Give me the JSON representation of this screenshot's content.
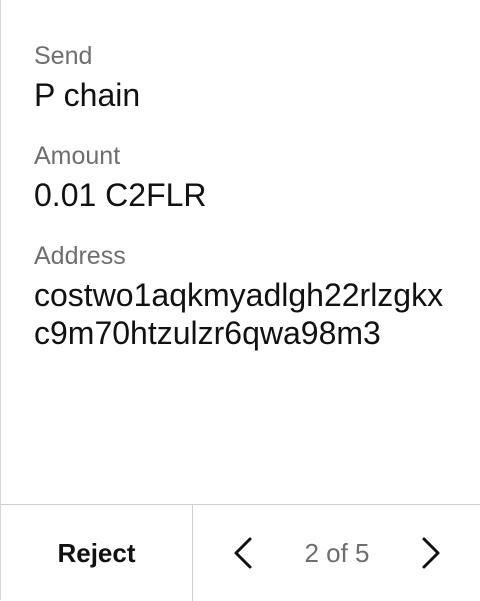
{
  "fields": [
    {
      "label": "Send",
      "value": "P chain"
    },
    {
      "label": "Amount",
      "value": "0.01 C2FLR"
    },
    {
      "label": "Address",
      "value": "costwo1aqkmyadlgh22rlzgkxc9m70htzulzr6qwa98m3"
    }
  ],
  "footer": {
    "reject_label": "Reject",
    "page_indicator": "2 of 5",
    "prev_icon": "chevron-left-icon",
    "next_icon": "chevron-right-icon"
  },
  "colors": {
    "label": "#6e6e6e",
    "value": "#111111",
    "divider": "#cfcfcf",
    "background": "#ffffff"
  }
}
